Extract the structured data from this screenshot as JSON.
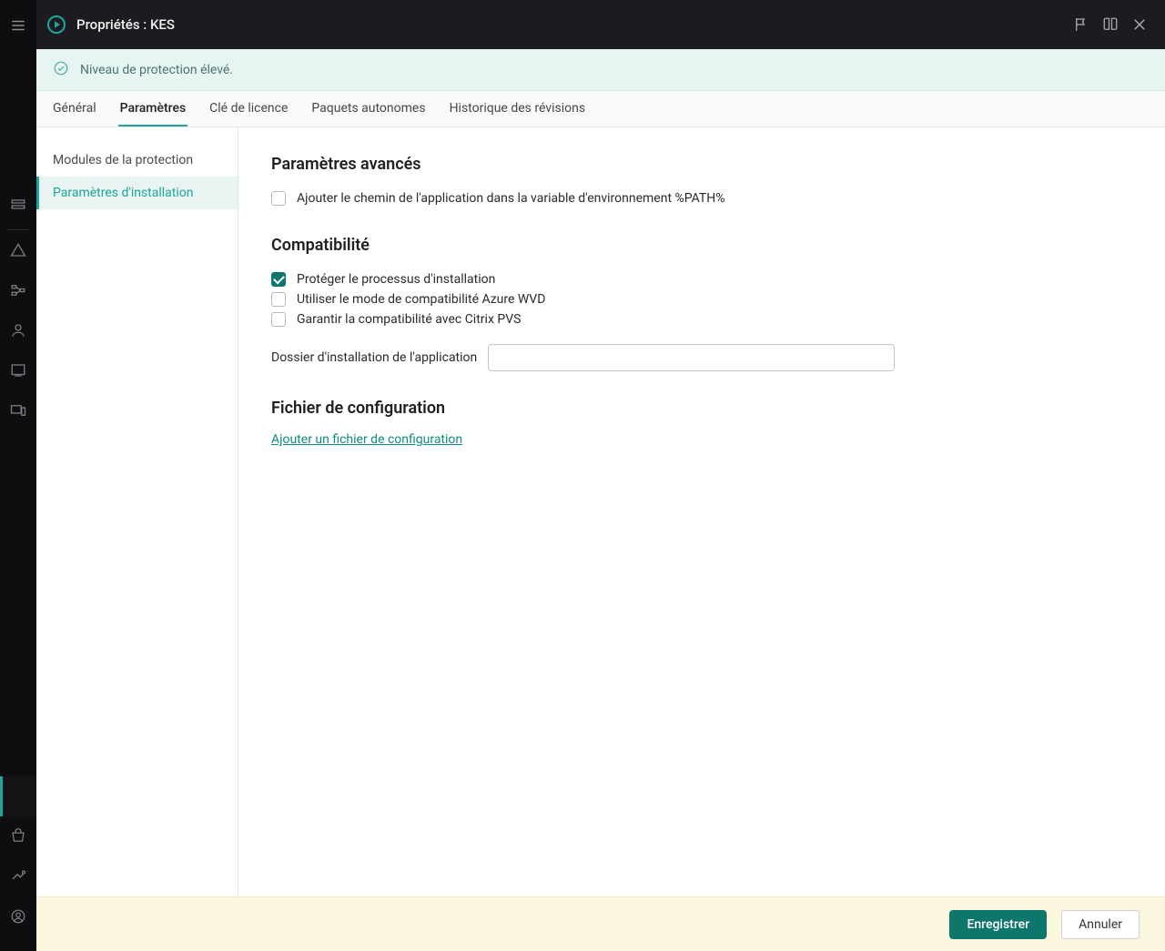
{
  "header": {
    "title": "Propriétés : KES"
  },
  "banner": {
    "message": "Niveau de protection élevé."
  },
  "tabs": [
    {
      "label": "Général",
      "active": false
    },
    {
      "label": "Paramètres",
      "active": true
    },
    {
      "label": "Clé de licence",
      "active": false
    },
    {
      "label": "Paquets autonomes",
      "active": false
    },
    {
      "label": "Historique des révisions",
      "active": false
    }
  ],
  "subnav": [
    {
      "label": "Modules de la protection",
      "active": false
    },
    {
      "label": "Paramètres d'installation",
      "active": true
    }
  ],
  "sections": {
    "advanced": {
      "title": "Paramètres avancés",
      "checks": [
        {
          "label": "Ajouter le chemin de l'application dans la variable d'environnement %PATH%",
          "checked": false
        }
      ]
    },
    "compat": {
      "title": "Compatibilité",
      "checks": [
        {
          "label": "Protéger le processus d'installation",
          "checked": true
        },
        {
          "label": "Utiliser le mode de compatibilité Azure WVD",
          "checked": false
        },
        {
          "label": "Garantir la compatibilité avec Citrix PVS",
          "checked": false
        }
      ],
      "install_folder_label": "Dossier d'installation de l'application",
      "install_folder_value": ""
    },
    "config": {
      "title": "Fichier de configuration",
      "link": "Ajouter un fichier de configuration"
    }
  },
  "footer": {
    "save": "Enregistrer",
    "cancel": "Annuler"
  }
}
